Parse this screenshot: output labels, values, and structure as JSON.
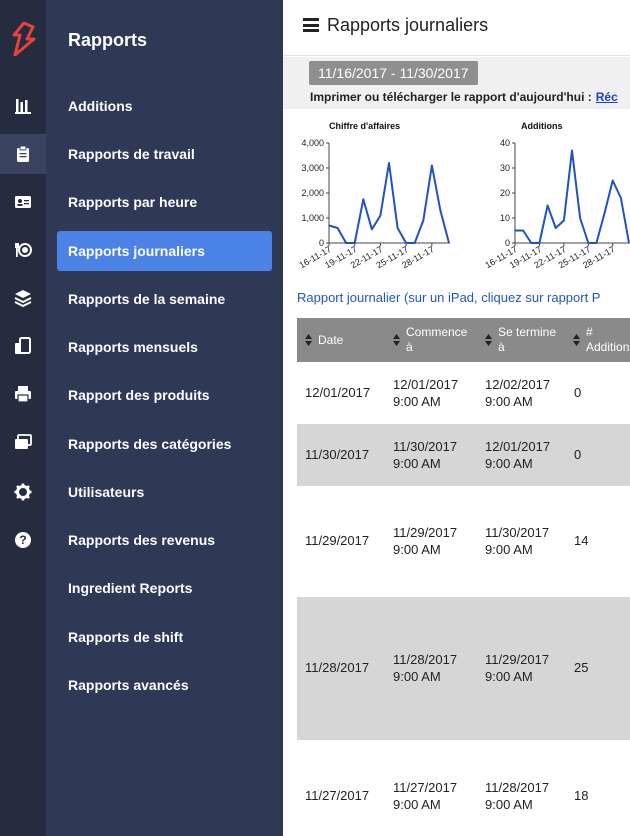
{
  "sidebar": {
    "title": "Rapports",
    "items": [
      {
        "label": "Additions"
      },
      {
        "label": "Rapports de travail"
      },
      {
        "label": "Rapports par heure"
      },
      {
        "label": "Rapports journaliers"
      },
      {
        "label": "Rapports de la semaine"
      },
      {
        "label": "Rapports mensuels"
      },
      {
        "label": "Rapport des produits"
      },
      {
        "label": "Rapports des catégories"
      },
      {
        "label": "Utilisateurs"
      },
      {
        "label": "Rapports des revenus"
      },
      {
        "label": "Ingredient Reports"
      },
      {
        "label": "Rapports de shift"
      },
      {
        "label": "Rapports avancés"
      }
    ],
    "active_index": 3
  },
  "icon_rail": [
    "lightspeed-logo",
    "bar-chart-icon",
    "clipboard-icon",
    "id-card-icon",
    "dining-icon",
    "layers-icon",
    "devices-icon",
    "printer-icon",
    "cards-icon",
    "gear-icon",
    "help-icon"
  ],
  "header": {
    "title": "Rapports journaliers"
  },
  "toolbar": {
    "date_range": "11/16/2017 - 11/30/2017",
    "print_label": "Imprimer ou télécharger le rapport d'aujourd'hui :",
    "print_link": "Réc"
  },
  "report_link": "Rapport journalier (sur un iPad, cliquez sur rapport P",
  "colors": {
    "rail": "#252c3f",
    "menu": "#2f3854",
    "accent": "#4b82e6",
    "line": "#2152c4",
    "table_header": "#8a8a8a",
    "row_alt": "#d6d6d6"
  },
  "chart_data": [
    {
      "type": "line",
      "title": "Chiffre d'affaires",
      "x": [
        "16-11-17",
        "17-11-17",
        "18-11-17",
        "19-11-17",
        "20-11-17",
        "21-11-17",
        "22-11-17",
        "23-11-17",
        "24-11-17",
        "25-11-17",
        "26-11-17",
        "27-11-17",
        "28-11-17",
        "29-11-17",
        "30-11-17"
      ],
      "x_tick_labels": [
        "16-11-17",
        "19-11-17",
        "22-11-17",
        "25-11-17",
        "28-11-17"
      ],
      "y": [
        700,
        600,
        0,
        0,
        1750,
        550,
        1100,
        3200,
        600,
        0,
        0,
        900,
        3100,
        1300,
        0
      ],
      "ylim": [
        0,
        4000
      ],
      "y_ticks": [
        "0",
        "1,000",
        "2,000",
        "3,000",
        "4,000"
      ],
      "grid": false
    },
    {
      "type": "line",
      "title": "Additions",
      "x": [
        "16-11-17",
        "17-11-17",
        "18-11-17",
        "19-11-17",
        "20-11-17",
        "21-11-17",
        "22-11-17",
        "23-11-17",
        "24-11-17",
        "25-11-17",
        "26-11-17",
        "27-11-17",
        "28-11-17",
        "29-11-17",
        "30-11-17"
      ],
      "x_tick_labels": [
        "16-11-17",
        "19-11-17",
        "22-11-17",
        "25-11-17",
        "28-11-17"
      ],
      "y": [
        5,
        5,
        0,
        0,
        15,
        6,
        9,
        37,
        10,
        0,
        0,
        12,
        25,
        18,
        0
      ],
      "ylim": [
        0,
        40
      ],
      "y_ticks": [
        "0",
        "10",
        "20",
        "30",
        "40"
      ],
      "grid": false
    }
  ],
  "table": {
    "headers": [
      "Date",
      "Commence à",
      "Se termine à",
      "# Additions"
    ],
    "rows": [
      {
        "date": "12/01/2017",
        "start": "12/01/2017",
        "start_time": "9:00 AM",
        "end": "12/02/2017",
        "end_time": "9:00 AM",
        "additions": "0"
      },
      {
        "date": "11/30/2017",
        "start": "11/30/2017",
        "start_time": "9:00 AM",
        "end": "12/01/2017",
        "end_time": "9:00 AM",
        "additions": "0"
      },
      {
        "date": "11/29/2017",
        "start": "11/29/2017",
        "start_time": "9:00 AM",
        "end": "11/30/2017",
        "end_time": "9:00 AM",
        "additions": "14"
      },
      {
        "date": "11/28/2017",
        "start": "11/28/2017",
        "start_time": "9:00 AM",
        "end": "11/29/2017",
        "end_time": "9:00 AM",
        "additions": "25"
      },
      {
        "date": "11/27/2017",
        "start": "11/27/2017",
        "start_time": "9:00 AM",
        "end": "11/28/2017",
        "end_time": "9:00 AM",
        "additions": "18"
      }
    ]
  }
}
